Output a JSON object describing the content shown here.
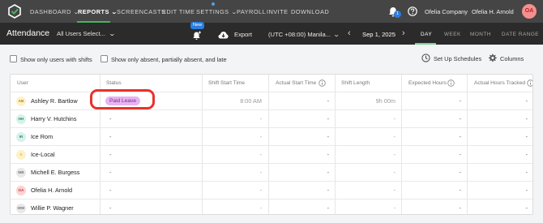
{
  "nav": {
    "items": [
      {
        "label": "DASHBOARD",
        "caret": true,
        "active": false
      },
      {
        "label": "REPORTS",
        "caret": true,
        "active": true
      },
      {
        "label": "SCREENCASTS",
        "caret": false,
        "active": false
      },
      {
        "label": "EDIT TIME",
        "caret": false,
        "active": false
      },
      {
        "label": "SETTINGS",
        "caret": true,
        "active": false
      },
      {
        "label": "PAYROLL",
        "caret": false,
        "active": false
      },
      {
        "label": "INVITE",
        "caret": false,
        "active": false
      },
      {
        "label": "DOWNLOAD",
        "caret": false,
        "active": false
      }
    ],
    "notification_count": "1",
    "company": "Ofelia Company",
    "user": "Ofelia H. Arnold",
    "avatar_initials": "OA"
  },
  "toolbar": {
    "title": "Attendance",
    "user_select": "All Users Select...",
    "new_badge": "New",
    "export_label": "Export",
    "timezone": "(UTC +08:00) Manila...",
    "date": "Sep 1, 2025",
    "prev_arrow": "‹",
    "next_arrow": "›",
    "views": [
      {
        "label": "DAY",
        "active": true
      },
      {
        "label": "WEEK",
        "active": false
      },
      {
        "label": "MONTH",
        "active": false
      },
      {
        "label": "DATE RANGE",
        "active": false
      }
    ]
  },
  "filters": {
    "shifts_only": "Show only users with shifts",
    "absent_only": "Show only absent, partially absent, and late",
    "setup_schedules": "Set Up Schedules",
    "columns": "Columns"
  },
  "table": {
    "headers": [
      "User",
      "Status",
      "Shift Start Time",
      "Actual Start Time",
      "Shift Length",
      "Expected Hours",
      "Actual Hours Tracked"
    ],
    "rows": [
      {
        "initials": "AB",
        "name": "Ashley R. Bartlow",
        "status": "Paid Leave",
        "shift_start": "8:00 AM",
        "actual_start": "-",
        "shift_length": "9h 00m",
        "expected": "-",
        "tracked": "-",
        "avatar_bg": "#fdf1c6",
        "avatar_fg": "#a8861f"
      },
      {
        "initials": "HH",
        "name": "Harry V. Hutchins",
        "status": "-",
        "shift_start": "-",
        "actual_start": "-",
        "shift_length": "-",
        "expected": "-",
        "tracked": "-",
        "avatar_bg": "#d6f2ea",
        "avatar_fg": "#2d8a72"
      },
      {
        "initials": "IR",
        "name": "Ice Rom",
        "status": "-",
        "shift_start": "-",
        "actual_start": "-",
        "shift_length": "-",
        "expected": "-",
        "tracked": "-",
        "avatar_bg": "#d6f2ea",
        "avatar_fg": "#2d8a72"
      },
      {
        "initials": "I",
        "name": "Ice-Local",
        "status": "-",
        "shift_start": "-",
        "actual_start": "-",
        "shift_length": "-",
        "expected": "-",
        "tracked": "-",
        "avatar_bg": "#fdf1c6",
        "avatar_fg": "#a8861f"
      },
      {
        "initials": "MB",
        "name": "Michell E. Burgess",
        "status": "-",
        "shift_start": "-",
        "actual_start": "-",
        "shift_length": "-",
        "expected": "-",
        "tracked": "-",
        "avatar_bg": "#e8e8e8",
        "avatar_fg": "#777777"
      },
      {
        "initials": "OA",
        "name": "Ofelia H. Arnold",
        "status": "-",
        "shift_start": "-",
        "actual_start": "-",
        "shift_length": "-",
        "expected": "-",
        "tracked": "-",
        "avatar_bg": "#fbd2d2",
        "avatar_fg": "#c03a3a"
      },
      {
        "initials": "WW",
        "name": "Willie P. Wagner",
        "status": "-",
        "shift_start": "-",
        "actual_start": "-",
        "shift_length": "-",
        "expected": "-",
        "tracked": "-",
        "avatar_bg": "#e8e8e8",
        "avatar_fg": "#777777"
      }
    ]
  },
  "colors": {
    "accent_green": "#46b35d",
    "badge_bg": "#e7b4f0",
    "badge_text": "#7b2a8c",
    "annotation_red": "#e8332a"
  }
}
